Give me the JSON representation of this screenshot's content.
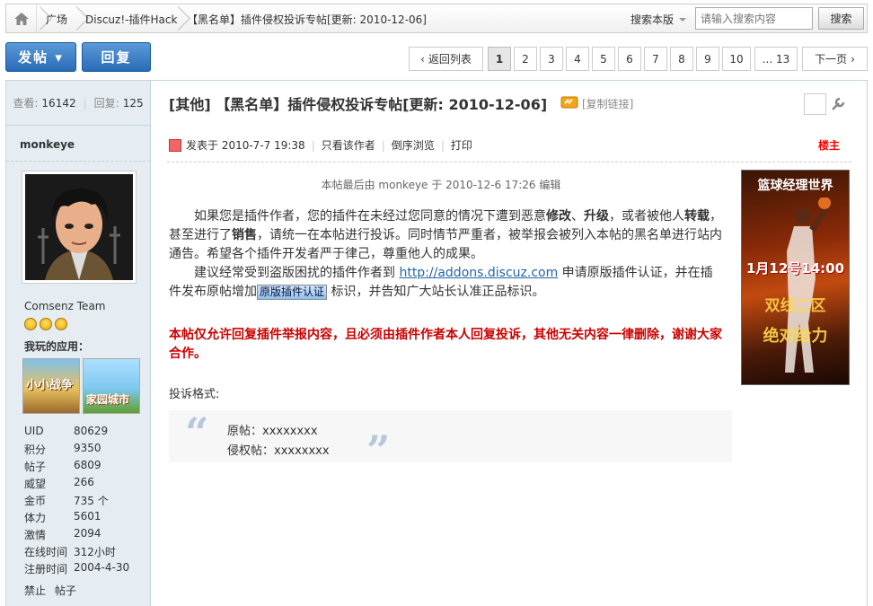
{
  "breadcrumb": {
    "items": [
      "广场",
      "Discuz!-插件Hack",
      "【黑名单】插件侵权投诉专帖[更新: 2010-12-06]"
    ],
    "search_type": "搜索本版",
    "search_placeholder": "请输入搜索内容",
    "search_button": "搜索"
  },
  "actions": {
    "post": "发帖 ▾",
    "reply": "回复"
  },
  "pagination": {
    "back": "返回列表",
    "pages": [
      "1",
      "2",
      "3",
      "4",
      "5",
      "6",
      "7",
      "8",
      "9",
      "10"
    ],
    "ellipsis_last": "... 13",
    "next": "下一页"
  },
  "sidebar": {
    "views_label": "查看:",
    "views": "16142",
    "replies_label": "回复:",
    "replies": "125",
    "username": "monkeye",
    "group": "Comsenz Team",
    "apps_title": "我玩的应用：",
    "app1": "小小战争",
    "app2": "家园城市",
    "profile": [
      {
        "k": "UID",
        "v": "80629"
      },
      {
        "k": "积分",
        "v": "9350"
      },
      {
        "k": "帖子",
        "v": "6809"
      },
      {
        "k": "威望",
        "v": "266"
      },
      {
        "k": "金币",
        "v": "735 个"
      },
      {
        "k": "体力",
        "v": "5601"
      },
      {
        "k": "激情",
        "v": "2094"
      },
      {
        "k": "在线时间",
        "v": "312小时"
      },
      {
        "k": "注册时间",
        "v": "2004-4-30"
      }
    ],
    "ban": "禁止",
    "posts": "帖子"
  },
  "post": {
    "title": "[其他] 【黑名单】插件侵权投诉专帖[更新: 2010-12-06]",
    "copy_link": "[复制链接]",
    "posted": "发表于 2010-7-7 19:38",
    "only_author": "只看该作者",
    "reverse": "倒序浏览",
    "print": "打印",
    "floor": "楼主",
    "edited": "本帖最后由 monkeye 于 2010-12-6 17:26 编辑",
    "p1a": "如果您是插件作者，您的插件在未经过您同意的情况下遭到恶意",
    "p1b": "修改",
    "p1c": "、",
    "p1d": "升级",
    "p1e": "，或者被他人",
    "p1f": "转载",
    "p1g": "，甚至进行了",
    "p1h": "销售",
    "p1i": "，请统一在本帖进行投诉。同时情节严重者，被举报会被列入本帖的黑名单进行站内通告。希望各个插件开发者严于律己，尊重他人的成果。",
    "p2a": "建议经常受到盗版困扰的插件作者到 ",
    "link": "http://addons.discuz.com",
    "p2b": " 申请原版插件认证，并在插件发布原帖增加",
    "badge": "原版插件认证",
    "p2c": "标识，并告知广大站长认准正品标识。",
    "warning": "本帖仅允许回复插件举报内容，且必须由插件作者本人回复投诉，其他无关内容一律删除，谢谢大家合作。",
    "format_label": "投诉格式:",
    "quote1": "原帖：xxxxxxxx",
    "quote2": "侵权帖：xxxxxxxx"
  },
  "ad": {
    "t1": "篮球经理世界",
    "t2": "1月12号14:00",
    "t3": "双线二区",
    "t4": "绝对给力"
  }
}
